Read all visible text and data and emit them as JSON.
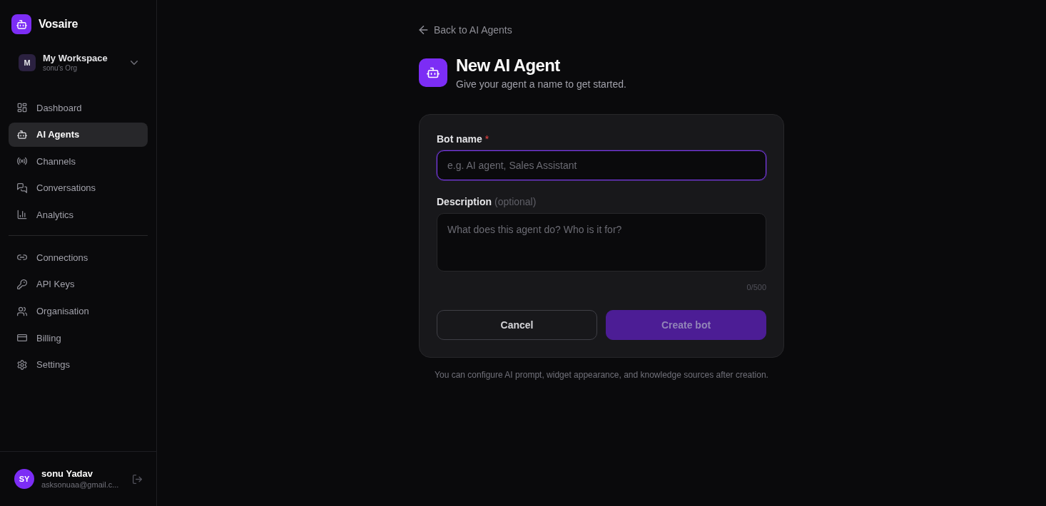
{
  "sidebar": {
    "brand": {
      "name": "Vosaire"
    },
    "workspace": {
      "initial": "M",
      "name": "My Workspace",
      "org": "sonu's Org"
    },
    "nav_sections": [
      {
        "items": [
          {
            "label": "Dashboard",
            "selected": false
          },
          {
            "label": "AI Agents",
            "selected": true
          },
          {
            "label": "Channels",
            "selected": false
          },
          {
            "label": "Conversations",
            "selected": false
          },
          {
            "label": "Analytics",
            "selected": false
          }
        ]
      },
      {
        "items": [
          {
            "label": "Connections",
            "selected": false
          },
          {
            "label": "API Keys",
            "selected": false
          },
          {
            "label": "Organisation",
            "selected": false
          },
          {
            "label": "Billing",
            "selected": false
          },
          {
            "label": "Settings",
            "selected": false
          }
        ]
      }
    ],
    "user": {
      "initials": "SY",
      "name": "sonu Yadav",
      "email": "asksonuaa@gmail.c..."
    }
  },
  "main": {
    "back_link": "Back to AI Agents",
    "title": "New AI Agent",
    "subtitle": "Give your agent a name to get started.",
    "form": {
      "fields": [
        {
          "kind": "input",
          "label": "Bot name",
          "required_mark": "*",
          "placeholder": "e.g. AI agent, Sales Assistant",
          "focused": true
        },
        {
          "kind": "textarea",
          "label": "Description",
          "hint": "(optional)",
          "placeholder": "What does this agent do? Who is it for?",
          "counter": "0/500",
          "focused": false
        }
      ],
      "buttons": [
        {
          "kind": "secondary",
          "label": "Cancel",
          "disabled": false
        },
        {
          "kind": "primary",
          "label": "Create bot",
          "disabled": true
        }
      ]
    },
    "note": "You can configure AI prompt, widget appearance, and knowledge sources after creation."
  }
}
